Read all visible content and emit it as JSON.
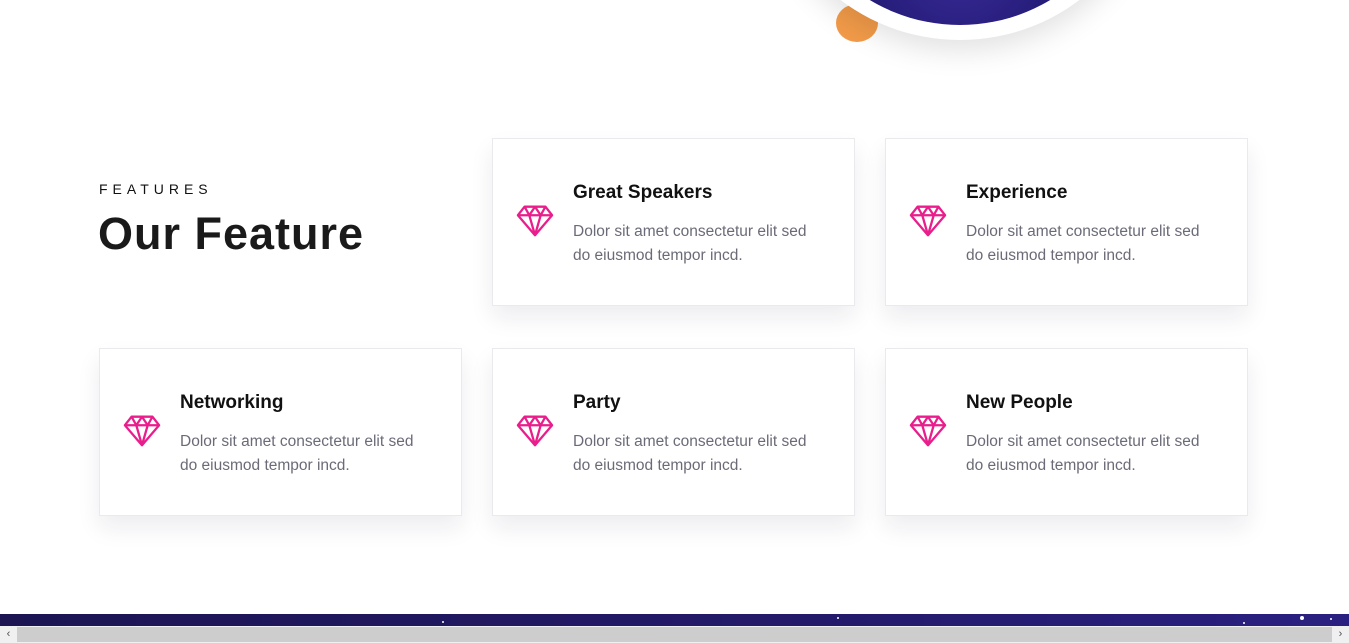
{
  "section": {
    "eyebrow": "FEATURES",
    "title": "Our Feature"
  },
  "accent_color": "#e91e8c",
  "icon": "diamond-icon",
  "features": [
    {
      "title": "Great Speakers",
      "text": "Dolor sit amet consectetur elit sed do eiusmod tempor incd."
    },
    {
      "title": "Experience",
      "text": "Dolor sit amet consectetur elit sed do eiusmod tempor incd."
    },
    {
      "title": "Networking",
      "text": "Dolor sit amet consectetur elit sed do eiusmod tempor incd."
    },
    {
      "title": "Party",
      "text": "Dolor sit amet consectetur elit sed do eiusmod tempor incd."
    },
    {
      "title": "New People",
      "text": "Dolor sit amet consectetur elit sed do eiusmod tempor incd."
    }
  ],
  "scrollbar": {
    "left_arrow": "‹",
    "right_arrow": "›"
  }
}
